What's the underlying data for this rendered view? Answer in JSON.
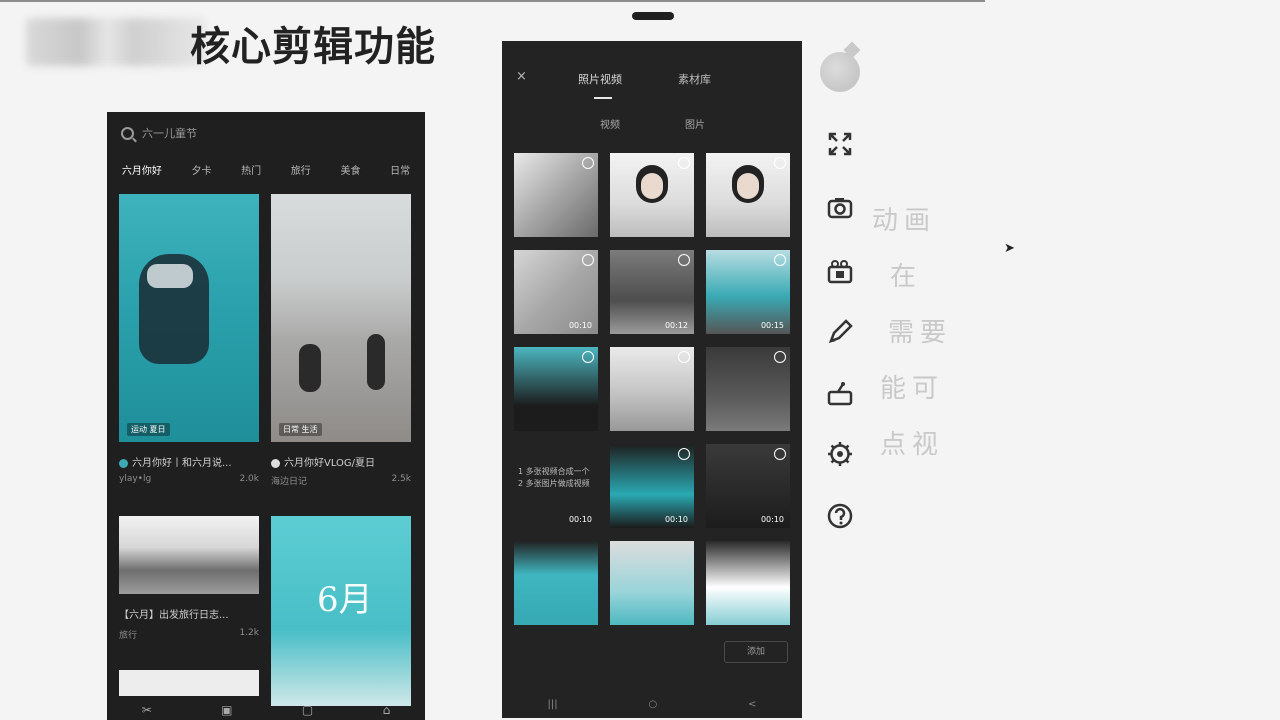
{
  "slide": {
    "title": "核心剪辑功能"
  },
  "left_phone": {
    "search_placeholder": "六一儿童节",
    "tabs": [
      "六月你好",
      "夕卡",
      "热门",
      "旅行",
      "美食",
      "日常"
    ],
    "cards": [
      {
        "badge": "运动 夏日",
        "caption": "六月你好丨和六月说...",
        "author": "ylay•lg",
        "likes": "2.0k"
      },
      {
        "badge": "日常 生活",
        "caption": "六月你好VLOG/夏日",
        "author": "海边日记",
        "likes": "2.5k"
      },
      {
        "caption": "【六月】出发旅行日志...",
        "author": "旅行",
        "likes": "1.2k"
      },
      {
        "big_text": "6月"
      }
    ],
    "nav": [
      "✂",
      "▣",
      "▢",
      "⌂"
    ]
  },
  "right_phone": {
    "close": "×",
    "tabs": [
      "照片视频",
      "素材库"
    ],
    "filters": [
      "视频",
      "图片"
    ],
    "thumbs": [
      {
        "dur": ""
      },
      {
        "dur": ""
      },
      {
        "dur": ""
      },
      {
        "dur": "00:10"
      },
      {
        "dur": "00:12"
      },
      {
        "dur": "00:15"
      },
      {
        "dur": ""
      },
      {
        "dur": ""
      },
      {
        "dur": ""
      },
      {
        "dur": "00:10"
      },
      {
        "dur": "00:10"
      },
      {
        "dur": "00:10"
      },
      {
        "dur": ""
      },
      {
        "dur": ""
      },
      {
        "dur": ""
      }
    ],
    "text_thumb": "1 多张视频合成一个\n2 多张图片做成视频",
    "next_button": "添加",
    "sys_nav": [
      "|||",
      "○",
      "<"
    ]
  },
  "toolbar": {
    "icons": [
      "expand-icon",
      "camera-icon",
      "video-camera-icon",
      "pen-icon",
      "projector-icon",
      "settings-icon",
      "help-icon"
    ]
  },
  "side_text": [
    "动画",
    "在",
    "需要",
    "能可",
    "点视"
  ]
}
